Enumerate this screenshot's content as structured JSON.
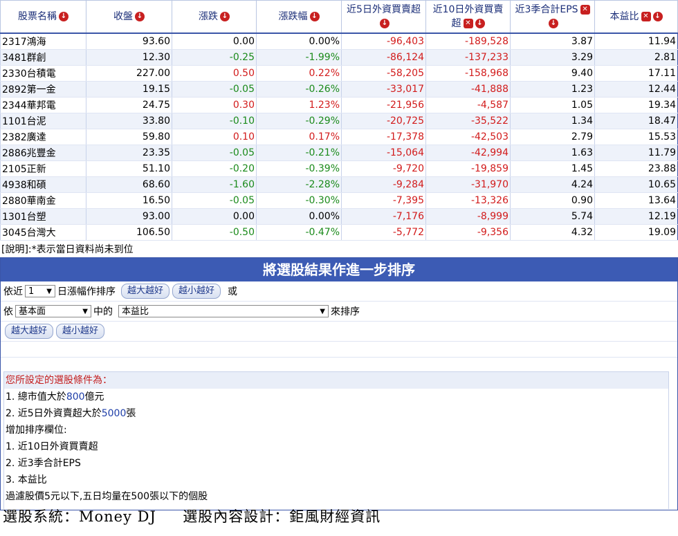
{
  "table": {
    "headers": [
      {
        "label": "股票名稱",
        "icons": [
          "sort-down"
        ]
      },
      {
        "label": "收盤",
        "icons": [
          "sort-down"
        ]
      },
      {
        "label": "漲跌",
        "icons": [
          "sort-down"
        ]
      },
      {
        "label": "漲跌幅",
        "icons": [
          "sort-down"
        ]
      },
      {
        "label": "近5日外資買賣超",
        "icons": [
          "sort-down"
        ]
      },
      {
        "label": "近10日外資買賣超",
        "icons": [
          "remove",
          "sort-down"
        ]
      },
      {
        "label": "近3季合計EPS",
        "icons": [
          "remove",
          "sort-down"
        ]
      },
      {
        "label": "本益比",
        "icons": [
          "remove",
          "sort-down"
        ]
      }
    ],
    "rows": [
      [
        "2317鴻海",
        "93.60",
        "0.00",
        "0.00%",
        "-96,403",
        "-189,528",
        "3.87",
        "11.94"
      ],
      [
        "3481群創",
        "12.30",
        "-0.25",
        "-1.99%",
        "-86,124",
        "-137,233",
        "3.29",
        "2.81"
      ],
      [
        "2330台積電",
        "227.00",
        "0.50",
        "0.22%",
        "-58,205",
        "-158,968",
        "9.40",
        "17.11"
      ],
      [
        "2892第一金",
        "19.15",
        "-0.05",
        "-0.26%",
        "-33,017",
        "-41,888",
        "1.23",
        "12.44"
      ],
      [
        "2344華邦電",
        "24.75",
        "0.30",
        "1.23%",
        "-21,956",
        "-4,587",
        "1.05",
        "19.34"
      ],
      [
        "1101台泥",
        "33.80",
        "-0.10",
        "-0.29%",
        "-20,725",
        "-35,522",
        "1.34",
        "18.47"
      ],
      [
        "2382廣達",
        "59.80",
        "0.10",
        "0.17%",
        "-17,378",
        "-42,503",
        "2.79",
        "15.53"
      ],
      [
        "2886兆豐金",
        "23.35",
        "-0.05",
        "-0.21%",
        "-15,064",
        "-42,994",
        "1.63",
        "11.79"
      ],
      [
        "2105正新",
        "51.10",
        "-0.20",
        "-0.39%",
        "-9,720",
        "-19,859",
        "1.45",
        "23.88"
      ],
      [
        "4938和碩",
        "68.60",
        "-1.60",
        "-2.28%",
        "-9,284",
        "-31,970",
        "4.24",
        "10.65"
      ],
      [
        "2880華南金",
        "16.50",
        "-0.05",
        "-0.30%",
        "-7,395",
        "-13,326",
        "0.90",
        "13.64"
      ],
      [
        "1301台塑",
        "93.00",
        "0.00",
        "0.00%",
        "-7,176",
        "-8,999",
        "5.74",
        "12.19"
      ],
      [
        "3045台灣大",
        "106.50",
        "-0.50",
        "-0.47%",
        "-5,772",
        "-9,356",
        "4.32",
        "19.09"
      ]
    ]
  },
  "note": "[說明]:*表示當日資料尚未到位",
  "sort_panel": {
    "title": "將選股結果作進一步排序",
    "row1": {
      "prefix": "依近",
      "days_value": "1",
      "suffix": "日漲幅作排序",
      "btn_desc": "越大越好",
      "btn_asc": "越小越好",
      "or": "或"
    },
    "row2": {
      "prefix": "依",
      "category_value": "基本面",
      "middle": "中的",
      "field_value": "本益比",
      "suffix": "來排序"
    },
    "row3": {
      "btn_desc": "越大越好",
      "btn_asc": "越小越好"
    }
  },
  "conditions": {
    "heading": "您所設定的選股條件為：",
    "c1_prefix": "1. 總市值大於",
    "c1_value": "800",
    "c1_suffix": "億元",
    "c2_prefix": "2. 近5日外資賣超大於",
    "c2_value": "5000",
    "c2_suffix": "張",
    "extra_heading": "增加排序欄位:",
    "extra": [
      "1. 近10日外資買賣超",
      "2. 近3季合計EPS",
      "3. 本益比"
    ],
    "filter": "過濾股價5元以下,五日均量在500張以下的個股"
  },
  "footer": "選股系統：Money DJ     選股內容設計：鉅風財經資訊",
  "colors": {
    "up": "#d21b1b",
    "down": "#1a8a1a",
    "accent": "#3c5bb4"
  }
}
